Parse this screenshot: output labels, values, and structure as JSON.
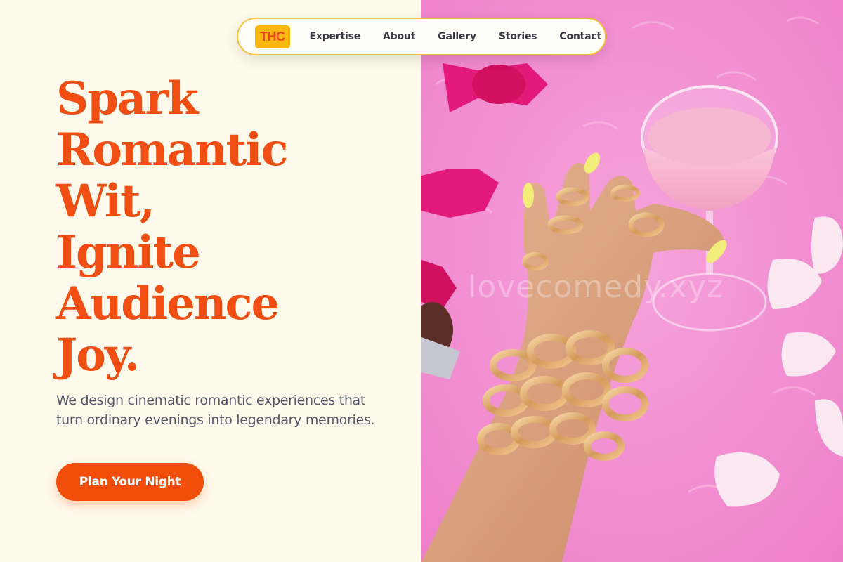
{
  "nav": {
    "logo": "THC",
    "links": [
      "Expertise",
      "About",
      "Gallery",
      "Stories",
      "Contact"
    ]
  },
  "hero": {
    "headline": [
      "Spark",
      "Romantic",
      "Wit,",
      "Ignite",
      "Audience",
      "Joy."
    ],
    "subtext": "We design cinematic romantic experiences that turn ordinary evenings into legendary memories.",
    "cta": "Plan Your Night"
  },
  "photo": {
    "watermark": "lovecomedy.xyz"
  },
  "colors": {
    "accent": "#f14e13",
    "logo_bg": "#fbb712",
    "background": "#fffaeb",
    "photo_pink": "#f08bd0"
  }
}
